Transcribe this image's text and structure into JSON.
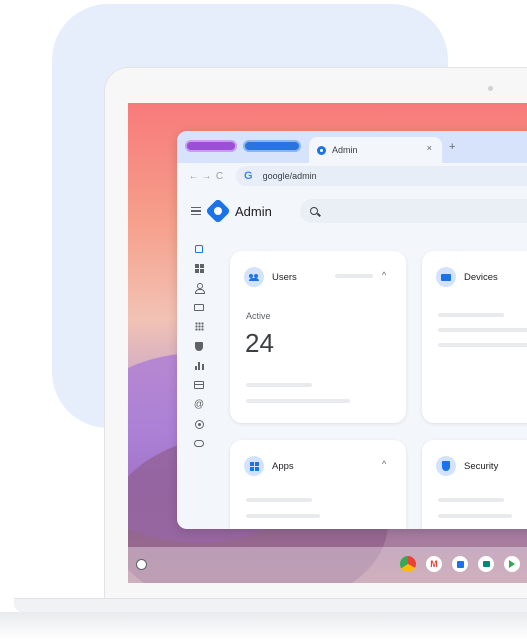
{
  "browser": {
    "active_tab": {
      "title": "Admin",
      "close_glyph": "×"
    },
    "new_tab_glyph": "+",
    "nav": {
      "back": "←",
      "forward": "→",
      "reload": "C"
    },
    "omnibox": {
      "logo": "G",
      "url": "google/admin"
    }
  },
  "app": {
    "title": "Admin",
    "search": {
      "placeholder": ""
    }
  },
  "rail": {
    "items": [
      "home-icon",
      "dashboard-grid-icon",
      "user-icon",
      "devices-icon",
      "apps-dots-icon",
      "security-shield-icon",
      "reports-chart-icon",
      "billing-card-icon",
      "account-at-icon",
      "rules-target-icon",
      "storage-cloud-icon"
    ]
  },
  "cards": {
    "users": {
      "title": "Users",
      "stat_label": "Active",
      "stat_value": "24",
      "chevron": "^"
    },
    "devices": {
      "title": "Devices"
    },
    "apps": {
      "title": "Apps",
      "chevron": "^"
    },
    "security": {
      "title": "Security"
    }
  },
  "colors": {
    "accent": "#1a73e8",
    "tab_purple": "#9a4fd6",
    "tab_blue": "#2a74e0"
  }
}
